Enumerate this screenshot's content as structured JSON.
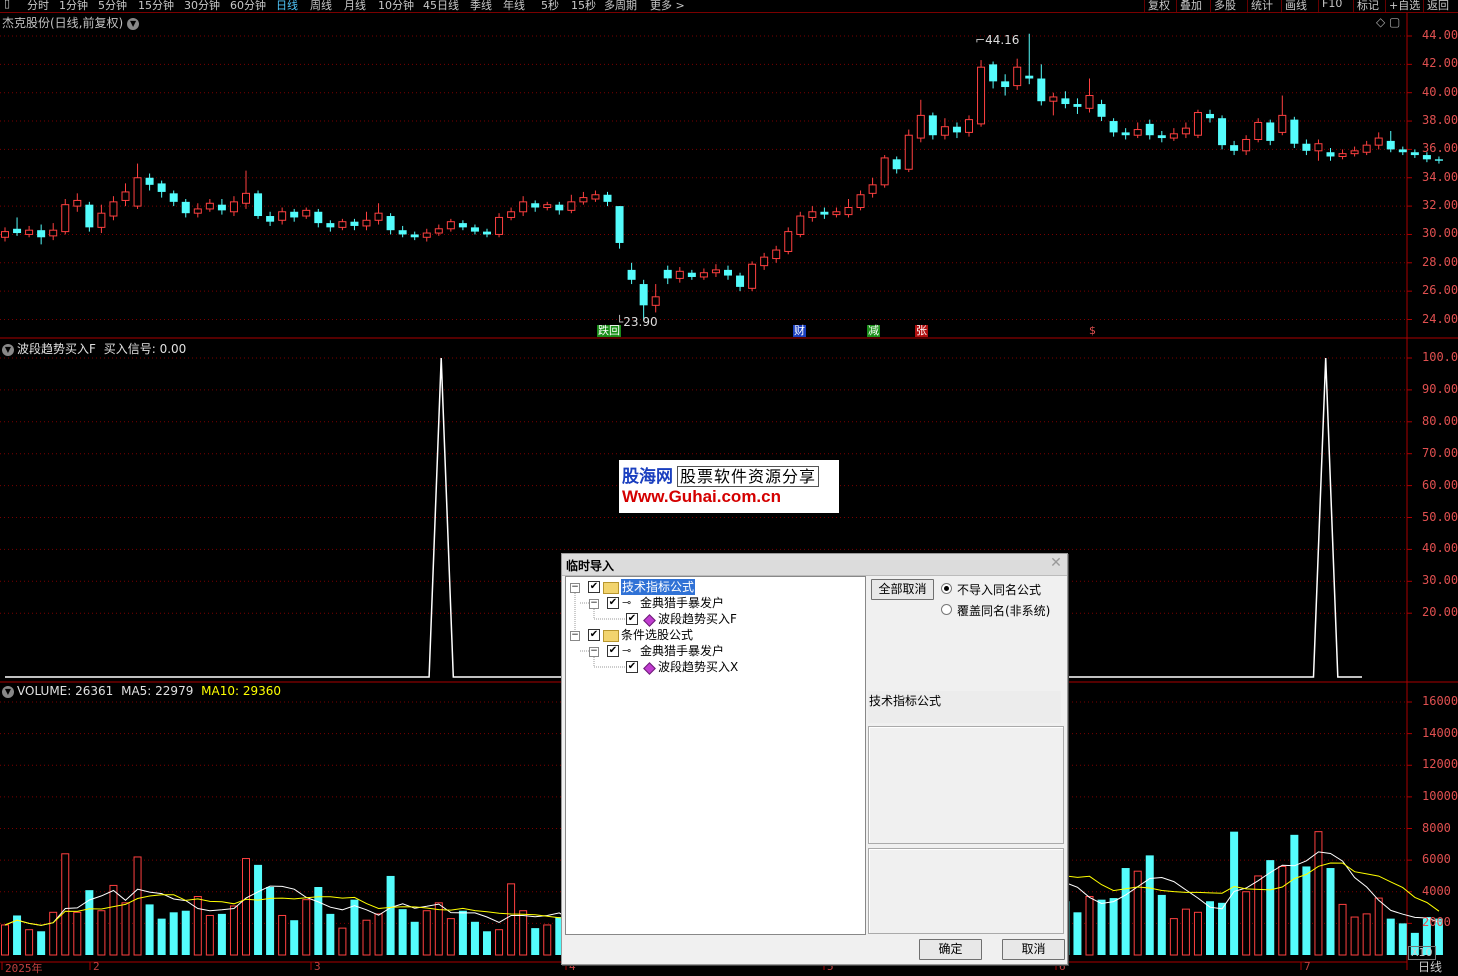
{
  "toolbar": {
    "periods": [
      "分时",
      "1分钟",
      "5分钟",
      "15分钟",
      "30分钟",
      "60分钟",
      "日线",
      "周线",
      "月线",
      "10分钟",
      "45日线",
      "季线",
      "年线",
      "5秒",
      "15秒",
      "多周期",
      "更多 >"
    ],
    "active_period": "日线",
    "right_buttons": [
      "复权",
      "叠加",
      "多股",
      "统计",
      "画线",
      "F10",
      "标记",
      "+自选",
      "返回"
    ]
  },
  "main_panel": {
    "title": "杰克股份(日线,前复权)",
    "high_label": "44.16",
    "low_label": "23.90",
    "axis_ticks": [
      "44.00",
      "42.00",
      "40.00",
      "38.00",
      "36.00",
      "34.00",
      "32.00",
      "30.00",
      "28.00",
      "26.00",
      "24.00"
    ],
    "event_marks": [
      {
        "text": "跌回",
        "bg": "#1a8f1a",
        "fg": "#ffffff"
      },
      {
        "text": "财",
        "bg": "#1a3fbf",
        "fg": "#ffffff"
      },
      {
        "text": "减",
        "bg": "#1a8f1a",
        "fg": "#ffffff"
      },
      {
        "text": "张",
        "bg": "#b01010",
        "fg": "#ffffff"
      },
      {
        "text": "$",
        "bg": "#000000",
        "fg": "#e05050"
      }
    ]
  },
  "indicator_panel": {
    "name": "波段趋势买入F",
    "signal_label": "买入信号: 0.00",
    "axis_ticks": [
      "100.0",
      "90.00",
      "80.00",
      "70.00",
      "60.00",
      "50.00",
      "40.00",
      "30.00",
      "20.00"
    ]
  },
  "volume_panel": {
    "label_volume": "VOLUME: 26361",
    "label_ma5": "MA5: 22979",
    "label_ma10": "MA10: 29360",
    "axis_ticks": [
      "16000",
      "14000",
      "12000",
      "10000",
      "8000",
      "6000",
      "4000",
      "2000"
    ],
    "unit": "X10",
    "period_tag": "日线",
    "date_labels": [
      "2025年",
      "2",
      "3",
      "4",
      "5",
      "6",
      "7"
    ]
  },
  "watermark": {
    "brand": "股海网",
    "subtitle": "股票软件资源分享",
    "url": "Www.Guhai.com.cn"
  },
  "dialog": {
    "title": "临时导入",
    "tree": [
      {
        "label": "技术指标公式",
        "level": 0,
        "type": "folder",
        "selected": true
      },
      {
        "label": "金典猎手暴发户",
        "level": 1,
        "type": "key"
      },
      {
        "label": "波段趋势买入F",
        "level": 2,
        "type": "formula"
      },
      {
        "label": "条件选股公式",
        "level": 0,
        "type": "folder"
      },
      {
        "label": "金典猎手暴发户",
        "level": 1,
        "type": "key"
      },
      {
        "label": "波段趋势买入X",
        "level": 2,
        "type": "formula"
      }
    ],
    "deselect_all": "全部取消",
    "radio_skip": "不导入同名公式",
    "radio_overwrite": "覆盖同名(非系统)",
    "category_label": "技术指标公式",
    "ok": "确定",
    "cancel": "取消"
  },
  "colors": {
    "up": "#ff4040",
    "down": "#54fcfc",
    "ma5": "#ffffff",
    "ma10": "#ffff00",
    "grid": "#7a0000"
  },
  "chart_data": [
    {
      "type": "candlestick",
      "title": "杰克股份(日线,前复权)",
      "ylim": [
        23.5,
        45
      ],
      "highest": 44.16,
      "lowest": 23.9,
      "candles": [
        {
          "o": 29.8,
          "c": 30.2,
          "h": 30.5,
          "l": 29.5
        },
        {
          "o": 30.4,
          "c": 30.1,
          "h": 31.2,
          "l": 29.9
        },
        {
          "o": 30.0,
          "c": 30.3,
          "h": 30.6,
          "l": 29.8
        },
        {
          "o": 30.3,
          "c": 29.8,
          "h": 30.7,
          "l": 29.3
        },
        {
          "o": 29.9,
          "c": 30.3,
          "h": 30.8,
          "l": 29.6
        },
        {
          "o": 30.2,
          "c": 32.1,
          "h": 32.5,
          "l": 30.0
        },
        {
          "o": 32.0,
          "c": 32.4,
          "h": 32.9,
          "l": 31.6
        },
        {
          "o": 32.1,
          "c": 30.5,
          "h": 32.3,
          "l": 30.2
        },
        {
          "o": 30.5,
          "c": 31.5,
          "h": 32.1,
          "l": 30.1
        },
        {
          "o": 31.3,
          "c": 32.3,
          "h": 32.7,
          "l": 31.0
        },
        {
          "o": 32.4,
          "c": 33.0,
          "h": 33.6,
          "l": 32.0
        },
        {
          "o": 32.0,
          "c": 34.0,
          "h": 35.0,
          "l": 31.8
        },
        {
          "o": 34.0,
          "c": 33.5,
          "h": 34.3,
          "l": 33.1
        },
        {
          "o": 33.6,
          "c": 33.0,
          "h": 33.8,
          "l": 32.6
        },
        {
          "o": 32.9,
          "c": 32.3,
          "h": 33.1,
          "l": 32.0
        },
        {
          "o": 32.3,
          "c": 31.5,
          "h": 32.5,
          "l": 31.2
        },
        {
          "o": 31.5,
          "c": 31.8,
          "h": 32.2,
          "l": 31.2
        },
        {
          "o": 31.8,
          "c": 32.2,
          "h": 32.5,
          "l": 31.6
        },
        {
          "o": 32.1,
          "c": 31.7,
          "h": 32.5,
          "l": 31.4
        },
        {
          "o": 31.6,
          "c": 32.3,
          "h": 32.7,
          "l": 31.3
        },
        {
          "o": 32.2,
          "c": 32.9,
          "h": 34.5,
          "l": 31.8
        },
        {
          "o": 32.9,
          "c": 31.3,
          "h": 33.1,
          "l": 31.1
        },
        {
          "o": 31.3,
          "c": 30.9,
          "h": 31.6,
          "l": 30.6
        },
        {
          "o": 31.0,
          "c": 31.6,
          "h": 31.9,
          "l": 30.7
        },
        {
          "o": 31.6,
          "c": 31.2,
          "h": 31.8,
          "l": 30.9
        },
        {
          "o": 31.3,
          "c": 31.7,
          "h": 31.9,
          "l": 31.1
        },
        {
          "o": 31.6,
          "c": 30.8,
          "h": 31.8,
          "l": 30.5
        },
        {
          "o": 30.8,
          "c": 30.5,
          "h": 31.0,
          "l": 30.2
        },
        {
          "o": 30.5,
          "c": 30.9,
          "h": 31.1,
          "l": 30.3
        },
        {
          "o": 30.9,
          "c": 30.6,
          "h": 31.1,
          "l": 30.3
        },
        {
          "o": 30.6,
          "c": 31.0,
          "h": 31.6,
          "l": 30.3
        },
        {
          "o": 31.0,
          "c": 31.5,
          "h": 32.2,
          "l": 30.7
        },
        {
          "o": 31.3,
          "c": 30.3,
          "h": 31.5,
          "l": 30.0
        },
        {
          "o": 30.3,
          "c": 30.0,
          "h": 30.6,
          "l": 29.8
        },
        {
          "o": 30.0,
          "c": 29.8,
          "h": 30.2,
          "l": 29.6
        },
        {
          "o": 29.8,
          "c": 30.1,
          "h": 30.4,
          "l": 29.5
        },
        {
          "o": 30.1,
          "c": 30.4,
          "h": 30.7,
          "l": 29.9
        },
        {
          "o": 30.4,
          "c": 30.9,
          "h": 31.1,
          "l": 30.2
        },
        {
          "o": 30.8,
          "c": 30.5,
          "h": 31.0,
          "l": 30.3
        },
        {
          "o": 30.5,
          "c": 30.2,
          "h": 30.7,
          "l": 30.0
        },
        {
          "o": 30.2,
          "c": 30.0,
          "h": 30.4,
          "l": 29.8
        },
        {
          "o": 30.0,
          "c": 31.2,
          "h": 31.5,
          "l": 29.8
        },
        {
          "o": 31.2,
          "c": 31.6,
          "h": 31.9,
          "l": 31.0
        },
        {
          "o": 31.6,
          "c": 32.3,
          "h": 32.7,
          "l": 31.3
        },
        {
          "o": 32.2,
          "c": 31.9,
          "h": 32.4,
          "l": 31.6
        },
        {
          "o": 31.9,
          "c": 32.1,
          "h": 32.3,
          "l": 31.7
        },
        {
          "o": 32.1,
          "c": 31.7,
          "h": 32.3,
          "l": 31.4
        },
        {
          "o": 31.7,
          "c": 32.3,
          "h": 32.8,
          "l": 31.5
        },
        {
          "o": 32.3,
          "c": 32.6,
          "h": 33.0,
          "l": 32.1
        },
        {
          "o": 32.5,
          "c": 32.8,
          "h": 33.1,
          "l": 32.3
        },
        {
          "o": 32.8,
          "c": 32.3,
          "h": 33.0,
          "l": 32.0
        },
        {
          "o": 32.0,
          "c": 29.4,
          "h": 32.0,
          "l": 29.0
        },
        {
          "o": 27.5,
          "c": 26.8,
          "h": 28.0,
          "l": 26.5
        },
        {
          "o": 26.5,
          "c": 25.0,
          "h": 26.8,
          "l": 23.9
        },
        {
          "o": 25.0,
          "c": 25.6,
          "h": 26.5,
          "l": 24.5
        },
        {
          "o": 27.5,
          "c": 26.9,
          "h": 27.8,
          "l": 26.5
        },
        {
          "o": 26.9,
          "c": 27.4,
          "h": 27.7,
          "l": 26.6
        },
        {
          "o": 27.3,
          "c": 27.0,
          "h": 27.5,
          "l": 26.8
        },
        {
          "o": 27.0,
          "c": 27.3,
          "h": 27.6,
          "l": 26.8
        },
        {
          "o": 27.3,
          "c": 27.5,
          "h": 27.9,
          "l": 27.0
        },
        {
          "o": 27.5,
          "c": 27.1,
          "h": 27.8,
          "l": 26.8
        },
        {
          "o": 27.1,
          "c": 26.3,
          "h": 27.3,
          "l": 26.0
        },
        {
          "o": 26.2,
          "c": 27.9,
          "h": 28.1,
          "l": 26.0
        },
        {
          "o": 27.8,
          "c": 28.4,
          "h": 28.7,
          "l": 27.5
        },
        {
          "o": 28.3,
          "c": 28.9,
          "h": 29.2,
          "l": 28.0
        },
        {
          "o": 28.8,
          "c": 30.2,
          "h": 30.5,
          "l": 28.6
        },
        {
          "o": 30.0,
          "c": 31.3,
          "h": 31.6,
          "l": 29.8
        },
        {
          "o": 31.2,
          "c": 31.6,
          "h": 32.0,
          "l": 30.9
        },
        {
          "o": 31.6,
          "c": 31.4,
          "h": 31.9,
          "l": 31.1
        },
        {
          "o": 31.4,
          "c": 31.6,
          "h": 31.9,
          "l": 31.2
        },
        {
          "o": 31.4,
          "c": 31.9,
          "h": 32.5,
          "l": 31.2
        },
        {
          "o": 31.9,
          "c": 32.8,
          "h": 33.1,
          "l": 31.7
        },
        {
          "o": 32.9,
          "c": 33.5,
          "h": 34.0,
          "l": 32.6
        },
        {
          "o": 33.5,
          "c": 35.4,
          "h": 35.6,
          "l": 33.3
        },
        {
          "o": 35.3,
          "c": 34.6,
          "h": 35.5,
          "l": 34.3
        },
        {
          "o": 34.6,
          "c": 37.0,
          "h": 37.4,
          "l": 34.4
        },
        {
          "o": 36.8,
          "c": 38.4,
          "h": 39.5,
          "l": 36.5
        },
        {
          "o": 38.4,
          "c": 37.0,
          "h": 38.6,
          "l": 36.7
        },
        {
          "o": 37.0,
          "c": 37.6,
          "h": 38.2,
          "l": 36.7
        },
        {
          "o": 37.6,
          "c": 37.2,
          "h": 37.9,
          "l": 36.8
        },
        {
          "o": 37.2,
          "c": 38.1,
          "h": 38.4,
          "l": 36.9
        },
        {
          "o": 37.8,
          "c": 41.8,
          "h": 42.3,
          "l": 37.6
        },
        {
          "o": 42.0,
          "c": 40.8,
          "h": 42.2,
          "l": 40.3
        },
        {
          "o": 40.8,
          "c": 40.4,
          "h": 41.3,
          "l": 39.8
        },
        {
          "o": 40.5,
          "c": 41.8,
          "h": 42.4,
          "l": 40.2
        },
        {
          "o": 41.2,
          "c": 41.0,
          "h": 44.16,
          "l": 40.6
        },
        {
          "o": 41.0,
          "c": 39.4,
          "h": 42.0,
          "l": 39.1
        },
        {
          "o": 39.4,
          "c": 39.7,
          "h": 40.0,
          "l": 38.4
        },
        {
          "o": 39.6,
          "c": 39.2,
          "h": 40.1,
          "l": 38.9
        },
        {
          "o": 39.2,
          "c": 39.0,
          "h": 39.6,
          "l": 38.5
        },
        {
          "o": 38.9,
          "c": 39.8,
          "h": 41.0,
          "l": 38.6
        },
        {
          "o": 39.2,
          "c": 38.3,
          "h": 39.5,
          "l": 38.0
        },
        {
          "o": 38.0,
          "c": 37.2,
          "h": 38.2,
          "l": 36.9
        },
        {
          "o": 37.2,
          "c": 37.0,
          "h": 37.5,
          "l": 36.7
        },
        {
          "o": 37.0,
          "c": 37.4,
          "h": 37.9,
          "l": 36.8
        },
        {
          "o": 37.8,
          "c": 37.0,
          "h": 38.1,
          "l": 36.7
        },
        {
          "o": 37.0,
          "c": 36.8,
          "h": 37.3,
          "l": 36.5
        },
        {
          "o": 36.8,
          "c": 37.1,
          "h": 37.5,
          "l": 36.6
        },
        {
          "o": 37.1,
          "c": 37.5,
          "h": 37.9,
          "l": 36.8
        },
        {
          "o": 37.0,
          "c": 38.6,
          "h": 38.8,
          "l": 36.8
        },
        {
          "o": 38.5,
          "c": 38.2,
          "h": 38.8,
          "l": 37.9
        },
        {
          "o": 38.2,
          "c": 36.3,
          "h": 38.4,
          "l": 36.0
        },
        {
          "o": 36.3,
          "c": 35.9,
          "h": 36.6,
          "l": 35.6
        },
        {
          "o": 35.9,
          "c": 36.7,
          "h": 37.0,
          "l": 35.6
        },
        {
          "o": 36.7,
          "c": 37.9,
          "h": 38.2,
          "l": 36.5
        },
        {
          "o": 37.9,
          "c": 36.6,
          "h": 38.1,
          "l": 36.3
        },
        {
          "o": 37.2,
          "c": 38.4,
          "h": 39.8,
          "l": 37.0
        },
        {
          "o": 38.1,
          "c": 36.4,
          "h": 38.3,
          "l": 36.1
        },
        {
          "o": 36.4,
          "c": 35.9,
          "h": 36.7,
          "l": 35.6
        },
        {
          "o": 35.9,
          "c": 36.4,
          "h": 36.7,
          "l": 35.2
        },
        {
          "o": 35.8,
          "c": 35.5,
          "h": 36.1,
          "l": 35.2
        },
        {
          "o": 35.5,
          "c": 35.7,
          "h": 36.0,
          "l": 35.3
        },
        {
          "o": 35.7,
          "c": 35.9,
          "h": 36.2,
          "l": 35.5
        },
        {
          "o": 35.8,
          "c": 36.3,
          "h": 36.6,
          "l": 35.6
        },
        {
          "o": 36.3,
          "c": 36.8,
          "h": 37.2,
          "l": 36.0
        },
        {
          "o": 36.6,
          "c": 36.0,
          "h": 37.3,
          "l": 35.8
        },
        {
          "o": 36.0,
          "c": 35.8,
          "h": 36.2,
          "l": 35.6
        },
        {
          "o": 35.8,
          "c": 35.6,
          "h": 36.0,
          "l": 35.4
        },
        {
          "o": 35.6,
          "c": 35.3,
          "h": 35.8,
          "l": 35.1
        },
        {
          "o": 35.3,
          "c": 35.2,
          "h": 35.5,
          "l": 35.0
        }
      ]
    },
    {
      "type": "line",
      "title": "波段趋势买入F",
      "ylim": [
        0,
        102
      ],
      "signal_peaks_at": [
        36,
        109
      ],
      "peak_value": 100,
      "length": 113
    },
    {
      "type": "bar",
      "title": "VOLUME",
      "ylim": [
        0,
        17000
      ],
      "volume": [
        1900,
        2500,
        1600,
        1500,
        2700,
        6400,
        2700,
        4100,
        2800,
        4400,
        3300,
        6200,
        3200,
        2300,
        2700,
        2800,
        3700,
        2500,
        2600,
        3100,
        6100,
        5700,
        4300,
        2500,
        2200,
        3500,
        4300,
        2600,
        1700,
        3500,
        2200,
        2600,
        5000,
        2900,
        2100,
        2800,
        3300,
        2300,
        2800,
        2100,
        1500,
        1600,
        4500,
        2800,
        1700,
        1900,
        2400,
        2100,
        1800,
        1600,
        2200,
        5000,
        9000,
        8500,
        5500,
        4000,
        3000,
        2200,
        2400,
        2000,
        1800,
        2600,
        4800,
        3400,
        3000,
        4200,
        5200,
        3700,
        2600,
        2400,
        3300,
        4200,
        6100,
        4400,
        3800,
        6500,
        9000,
        6700,
        3800,
        3600,
        3000,
        8800,
        7400,
        4300,
        4200,
        6900,
        5400,
        3000,
        3400,
        2700,
        3700,
        3500,
        3600,
        5500,
        5300,
        6300,
        3800,
        2300,
        2900,
        2700,
        3400,
        3300,
        7800,
        4000,
        5000,
        6000,
        5600,
        7600,
        5600,
        7800,
        5500,
        3200,
        2400,
        2600,
        3600,
        2300,
        2000,
        1400,
        2400,
        2300,
        2200,
        2600
      ],
      "ma5_last": 22979,
      "ma10_last": 29360,
      "last": 26361
    }
  ]
}
